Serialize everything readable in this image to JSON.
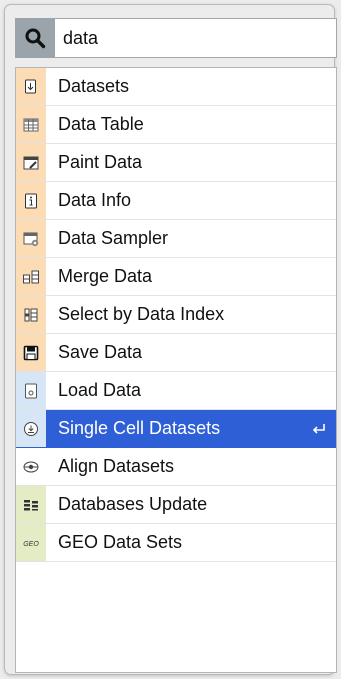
{
  "search": {
    "query": "data"
  },
  "items": [
    {
      "label": "Datasets",
      "icon": "file-download-icon",
      "color": "#fbdcb5"
    },
    {
      "label": "Data Table",
      "icon": "table-icon",
      "color": "#fbdcb5"
    },
    {
      "label": "Paint Data",
      "icon": "paint-icon",
      "color": "#fbdcb5"
    },
    {
      "label": "Data Info",
      "icon": "info-icon",
      "color": "#fbdcb5"
    },
    {
      "label": "Data Sampler",
      "icon": "sampler-icon",
      "color": "#fbdcb5"
    },
    {
      "label": "Merge Data",
      "icon": "merge-icon",
      "color": "#fbdcb5"
    },
    {
      "label": "Select by Data Index",
      "icon": "select-index-icon",
      "color": "#fbdcb5"
    },
    {
      "label": "Save Data",
      "icon": "save-icon",
      "color": "#fbdcb5"
    },
    {
      "label": "Load Data",
      "icon": "file-icon",
      "color": "#d7e6f7"
    },
    {
      "label": "Single Cell Datasets",
      "icon": "circle-download-icon",
      "color": "#d7e6f7",
      "selected": true
    },
    {
      "label": "Align Datasets",
      "icon": "align-icon",
      "color": "#ffffff"
    },
    {
      "label": "Databases Update",
      "icon": "database-icon",
      "color": "#e4ecc5"
    },
    {
      "label": "GEO Data Sets",
      "icon": "geo-icon",
      "color": "#e4ecc5"
    }
  ],
  "colors": {
    "accent": "#2f5fd7",
    "search_button": "#9aa4ab"
  }
}
